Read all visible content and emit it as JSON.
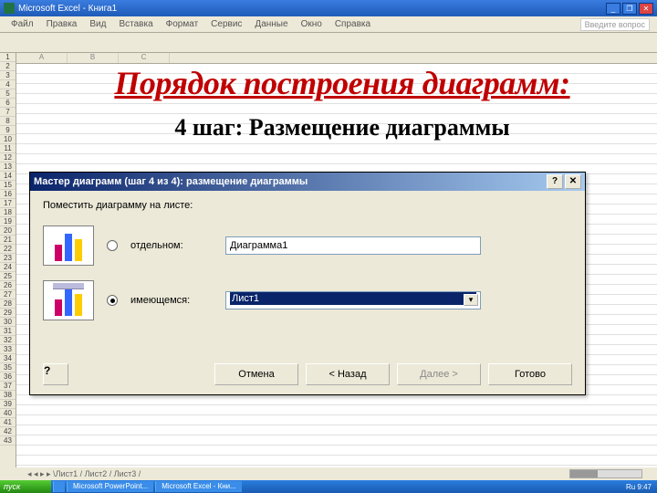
{
  "app": {
    "title": "Microsoft Excel - Книга1"
  },
  "menu": {
    "items": [
      "Файл",
      "Правка",
      "Вид",
      "Вставка",
      "Формат",
      "Сервис",
      "Данные",
      "Окно",
      "Справка"
    ],
    "type_question": "Введите вопрос"
  },
  "slide": {
    "title": "Порядок построения диаграмм:",
    "subtitle": "4 шаг: Размещение диаграммы"
  },
  "dialog": {
    "title": "Мастер диаграмм (шаг 4 из 4): размещение диаграммы",
    "place_label": "Поместить диаграмму на листе:",
    "separate_label": "отдельном:",
    "separate_value": "Диаграмма1",
    "existing_label": "имеющемся:",
    "existing_value": "Лист1",
    "help": "?",
    "close": "✕",
    "btn_help": "?",
    "btn_cancel": "Отмена",
    "btn_back": "< Назад",
    "btn_next": "Далее >",
    "btn_finish": "Готово"
  },
  "sheet_tabs": "◂ ◂ ▸ ▸ \\Лист1 / Лист2 / Лист3 /",
  "taskbar": {
    "start": "пуск",
    "items": [
      "",
      "Microsoft PowerPoint...",
      "Microsoft Excel - Кни..."
    ],
    "tray": "Ru 9:47"
  }
}
